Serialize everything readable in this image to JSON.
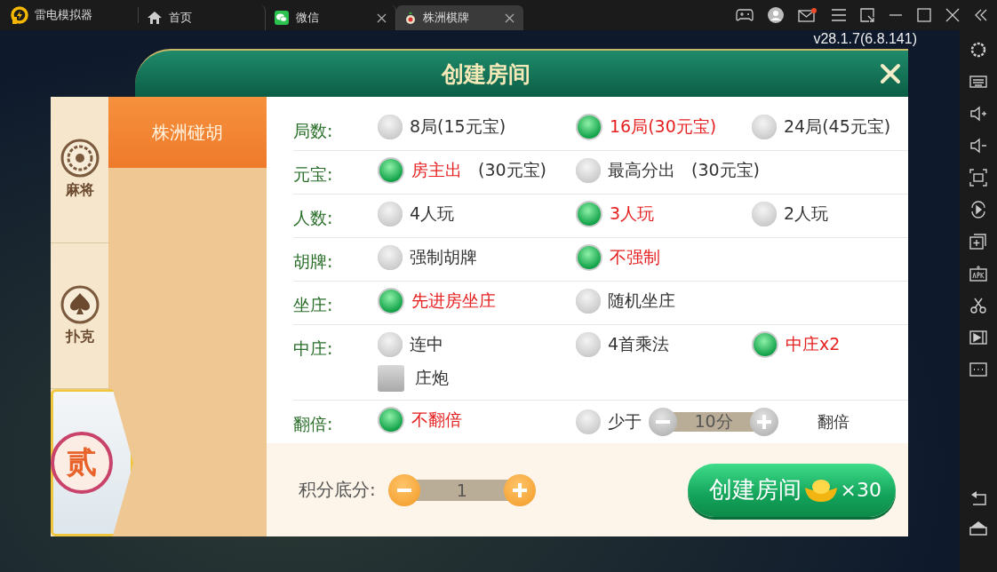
{
  "titlebar": {
    "app_name": "雷电模拟器",
    "tabs": [
      {
        "label": "首页",
        "kind": "home",
        "selected": false,
        "closable": false
      },
      {
        "label": "微信",
        "kind": "chat",
        "selected": false,
        "closable": true
      },
      {
        "label": "株洲棋牌",
        "kind": "game",
        "selected": true,
        "closable": true
      }
    ],
    "mail_unread": true
  },
  "version": "v28.1.7(6.8.141)",
  "dialog": {
    "title": "创建房间",
    "categories": [
      {
        "label": "麻将",
        "kind": "mahjong",
        "selected": false
      },
      {
        "label": "扑克",
        "kind": "poker",
        "selected": false
      },
      {
        "label": "贰",
        "kind": "medal",
        "selected": true
      }
    ],
    "games": [
      {
        "label": "株洲碰胡",
        "selected": true
      }
    ],
    "rules": [
      {
        "label": "局数:",
        "options": [
          {
            "kind": "radio",
            "label": "8局(15元宝)",
            "selected": false
          },
          {
            "kind": "radio",
            "label": "16局(30元宝)",
            "selected": true
          },
          {
            "kind": "radio",
            "label": "24局(45元宝)",
            "selected": false
          }
        ]
      },
      {
        "label": "元宝:",
        "options": [
          {
            "kind": "radio",
            "label": "房主出",
            "note": "(30元宝)",
            "selected": true
          },
          {
            "kind": "radio",
            "label": "最高分出",
            "note": "(30元宝)",
            "selected": false
          }
        ]
      },
      {
        "label": "人数:",
        "options": [
          {
            "kind": "radio",
            "label": "4人玩",
            "selected": false
          },
          {
            "kind": "radio",
            "label": "3人玩",
            "selected": true
          },
          {
            "kind": "radio",
            "label": "2人玩",
            "selected": false
          }
        ]
      },
      {
        "label": "胡牌:",
        "options": [
          {
            "kind": "radio",
            "label": "强制胡牌",
            "selected": false
          },
          {
            "kind": "radio",
            "label": "不强制",
            "selected": true
          }
        ]
      },
      {
        "label": "坐庄:",
        "options": [
          {
            "kind": "radio",
            "label": "先进房坐庄",
            "selected": true
          },
          {
            "kind": "radio",
            "label": "随机坐庄",
            "selected": false
          }
        ]
      },
      {
        "label": "中庄:",
        "options": [
          {
            "kind": "radio",
            "label": "连中",
            "selected": false
          },
          {
            "kind": "radio",
            "label": "4首乘法",
            "selected": false
          },
          {
            "kind": "radio",
            "label": "中庄x2",
            "selected": true
          },
          {
            "kind": "checkbox",
            "label": "庄炮",
            "checked": false
          }
        ]
      },
      {
        "label": "翻倍:",
        "options": [
          {
            "kind": "radio",
            "label": "不翻倍",
            "selected": true
          },
          {
            "kind": "stepper",
            "label": "少于",
            "value": "10分",
            "suffix": "翻倍",
            "selected": false
          }
        ]
      }
    ],
    "footer": {
      "label": "积分底分:",
      "value": "1"
    },
    "create_button": {
      "label": "创建房间",
      "cost": "×30"
    }
  }
}
